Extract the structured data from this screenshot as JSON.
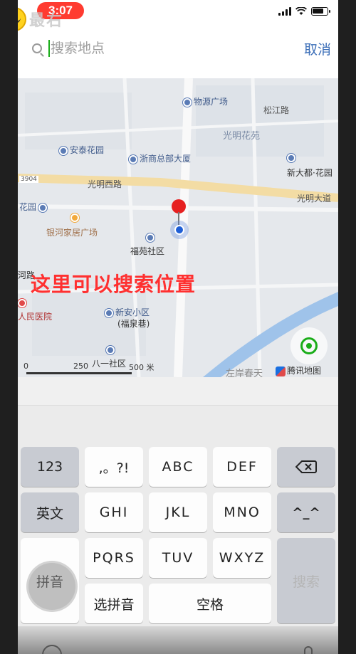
{
  "status_bar": {
    "time": "3:07",
    "battery_level": 0.8
  },
  "watermark": {
    "text": "最右"
  },
  "search": {
    "placeholder": "搜索地点",
    "value": "",
    "cancel_label": "取消"
  },
  "map": {
    "labels": {
      "wuyuan": "物源广场",
      "songjiang": "松江路",
      "guangming_garden": "光明花苑",
      "antai": "安泰花园",
      "zheshang": "浙商总部大厦",
      "xindadu": "新大都·花园",
      "road_code": "3904",
      "guangming_west": "光明西路",
      "guangming_ave": "光明大道",
      "huayuan": "花园",
      "yinhe": "银河家居广场",
      "fuyuan": "福苑社区",
      "hehe": "河路",
      "hospital": "人民医院",
      "xinan": "新安小区",
      "fuquan": "(福泉巷)",
      "bayi": "八一社区",
      "zuoan": "左岸春天",
      "tencent": "腾讯地图",
      "scale_0": "0",
      "scale_250": "250",
      "scale_500": "500 米"
    },
    "annotation": "这里可以搜索位置"
  },
  "keyboard": {
    "num_key": "123",
    "punct_key": ",。?!",
    "abc_key": "ABC",
    "def_key": "DEF",
    "en_key": "英文",
    "ghi_key": "GHI",
    "jkl_key": "JKL",
    "mno_key": "MNO",
    "emoji_key": "^_^",
    "pinyin_key": "拼音",
    "pqrs_key": "PQRS",
    "tuv_key": "TUV",
    "wxyz_key": "WXYZ",
    "search_key": "搜索",
    "select_pinyin_key": "选拼音",
    "space_key": "空格"
  },
  "icons": [
    "search-icon",
    "backspace-icon",
    "locate-icon",
    "globe-icon",
    "mic-icon"
  ],
  "colors": {
    "accent": "#3d6fb8",
    "annotation": "#ff3030",
    "time_pill": "#ff3b30",
    "locate": "#1aad19"
  }
}
